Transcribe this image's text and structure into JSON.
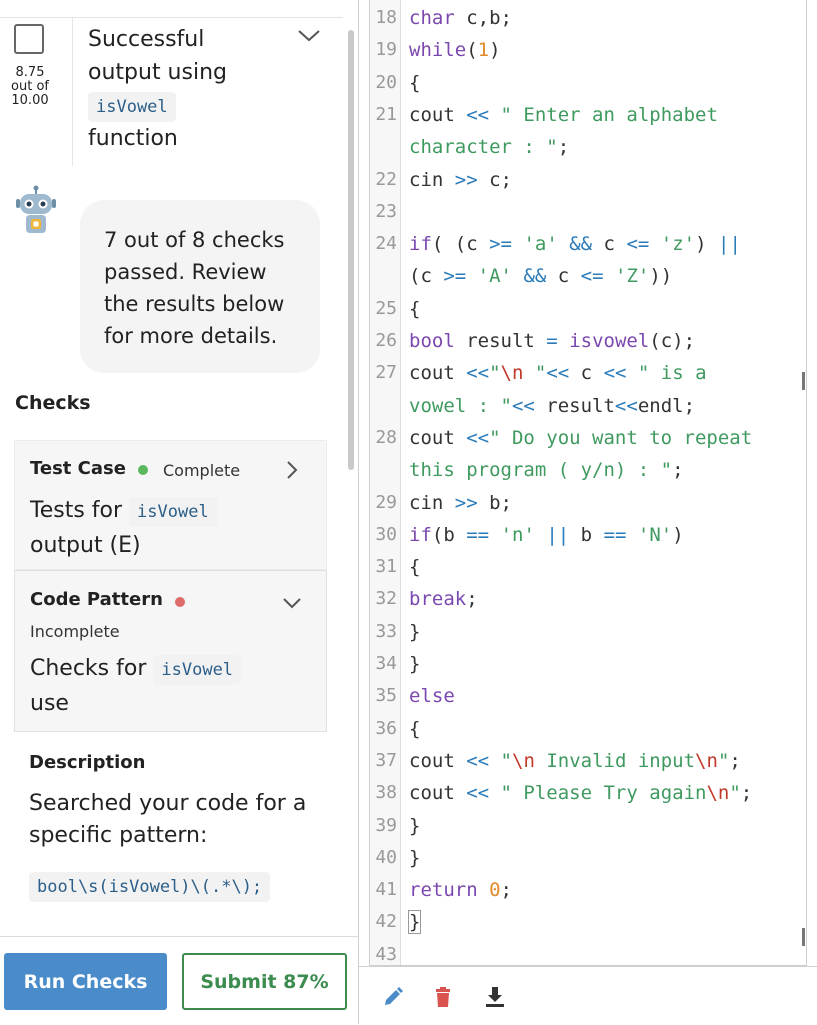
{
  "rubric": {
    "score_value": "8.75",
    "score_suffix": "out of",
    "score_max": "10.00",
    "title_line1": "Successful",
    "title_line2": "output using",
    "title_code": "isVowel",
    "title_line4": "function"
  },
  "bubble": {
    "text": "7 out of 8 checks passed. Review the results below for more details."
  },
  "checks": {
    "heading": "Checks",
    "test_case": {
      "label": "Test Case",
      "status": "Complete",
      "desc_prefix": "Tests for",
      "desc_code": "isVowel",
      "desc_suffix": "output (E)"
    },
    "code_pattern": {
      "label": "Code Pattern",
      "status": "Incomplete",
      "desc_prefix": "Checks for",
      "desc_code": "isVowel",
      "desc_suffix": "use"
    },
    "description": {
      "label": "Description",
      "text": "Searched your code for a specific pattern:",
      "pattern": "bool\\s(isVowel)\\(.*\\);"
    }
  },
  "buttons": {
    "run": "Run Checks",
    "submit": "Submit 87%"
  },
  "colors": {
    "keyword": "#7b48b0",
    "string": "#3f9a5f",
    "number": "#e08a2a",
    "escape": "#c0392b",
    "operator": "#2b7bb9",
    "complete": "#5cb85c",
    "incomplete": "#e06b6b",
    "run_button": "#4a8cc9",
    "submit_button": "#3c8c4f"
  },
  "toolbar_icons": [
    "pencil-icon",
    "trash-icon",
    "download-icon"
  ],
  "code_lines": [
    {
      "n": "18",
      "html": "<span style='color:#7b48b0'>char</span> c,b;"
    },
    {
      "n": "19",
      "html": "<span style='color:#7b48b0'>while</span>(<span style='color:#e08a2a'>1</span>)"
    },
    {
      "n": "20",
      "html": "{"
    },
    {
      "n": "21",
      "html": "cout <span style='color:#2b7bb9'>&lt;&lt;</span> <span style='color:#3f9a5f'>\" Enter an alphabet</span>"
    },
    {
      "n": "",
      "html": "<span style='color:#3f9a5f'>character : \"</span>;"
    },
    {
      "n": "22",
      "html": "cin <span style='color:#2b7bb9'>&gt;&gt;</span> c;"
    },
    {
      "n": "23",
      "html": ""
    },
    {
      "n": "24",
      "html": "<span style='color:#7b48b0'>if</span>( (c <span style='color:#2b7bb9'>&gt;=</span> <span style='color:#3f9a5f'>'a'</span> <span style='color:#2b7bb9'>&amp;&amp;</span> c <span style='color:#2b7bb9'>&lt;=</span> <span style='color:#3f9a5f'>'z'</span>) <span style='color:#2b7bb9'>||</span>"
    },
    {
      "n": "",
      "html": "(c <span style='color:#2b7bb9'>&gt;=</span> <span style='color:#3f9a5f'>'A'</span> <span style='color:#2b7bb9'>&amp;&amp;</span> c <span style='color:#2b7bb9'>&lt;=</span> <span style='color:#3f9a5f'>'Z'</span>))"
    },
    {
      "n": "25",
      "html": "{"
    },
    {
      "n": "26",
      "html": "<span style='color:#7b48b0'>bool</span> result <span style='color:#2b7bb9'>=</span> <span style='color:#7b48b0'>isvowel</span>(c);"
    },
    {
      "n": "27",
      "html": "cout <span style='color:#2b7bb9'>&lt;&lt;</span><span style='color:#3f9a5f'>\"</span><span style='color:#c0392b'>\\n</span> <span style='color:#3f9a5f'>\"</span><span style='color:#2b7bb9'>&lt;&lt;</span> c <span style='color:#2b7bb9'>&lt;&lt;</span> <span style='color:#3f9a5f'>\" is a</span>"
    },
    {
      "n": "",
      "html": "<span style='color:#3f9a5f'>vowel : \"</span><span style='color:#2b7bb9'>&lt;&lt;</span> result<span style='color:#2b7bb9'>&lt;&lt;</span>endl;"
    },
    {
      "n": "28",
      "html": "cout <span style='color:#2b7bb9'>&lt;&lt;</span><span style='color:#3f9a5f'>\" Do you want to repeat</span>"
    },
    {
      "n": "",
      "html": "<span style='color:#3f9a5f'>this program ( y/n) : \"</span>;"
    },
    {
      "n": "29",
      "html": "cin <span style='color:#2b7bb9'>&gt;&gt;</span> b;"
    },
    {
      "n": "30",
      "html": "<span style='color:#7b48b0'>if</span>(b <span style='color:#2b7bb9'>==</span> <span style='color:#3f9a5f'>'n'</span> <span style='color:#2b7bb9'>||</span> b <span style='color:#2b7bb9'>==</span> <span style='color:#3f9a5f'>'N'</span>)"
    },
    {
      "n": "31",
      "html": "{"
    },
    {
      "n": "32",
      "html": "<span style='color:#7b48b0'>break</span>;"
    },
    {
      "n": "33",
      "html": "}"
    },
    {
      "n": "34",
      "html": "}"
    },
    {
      "n": "35",
      "html": "<span style='color:#7b48b0'>else</span>"
    },
    {
      "n": "36",
      "html": "{"
    },
    {
      "n": "37",
      "html": "cout <span style='color:#2b7bb9'>&lt;&lt;</span> <span style='color:#3f9a5f'>\"</span><span style='color:#c0392b'>\\n</span><span style='color:#3f9a5f'> Invalid input</span><span style='color:#c0392b'>\\n</span><span style='color:#3f9a5f'>\"</span>;"
    },
    {
      "n": "38",
      "html": "cout <span style='color:#2b7bb9'>&lt;&lt;</span> <span style='color:#3f9a5f'>\" Please Try again</span><span style='color:#c0392b'>\\n</span><span style='color:#3f9a5f'>\"</span>;"
    },
    {
      "n": "39",
      "html": "}"
    },
    {
      "n": "40",
      "html": "}"
    },
    {
      "n": "41",
      "html": "<span style='color:#7b48b0'>return</span> <span style='color:#e08a2a'>0</span>;"
    },
    {
      "n": "42",
      "html": "<span style='outline:1px solid #999'>}</span>"
    },
    {
      "n": "43",
      "html": ""
    }
  ]
}
